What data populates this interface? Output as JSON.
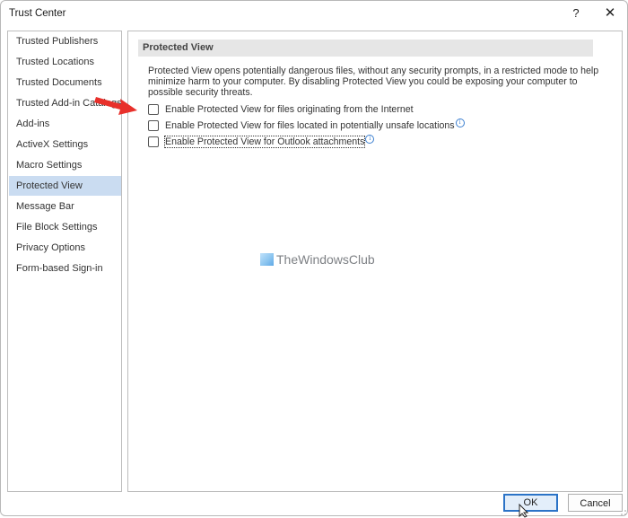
{
  "window": {
    "title": "Trust Center",
    "help_label": "?",
    "close_label": "✕"
  },
  "sidebar": {
    "selected_index": 8,
    "items": [
      {
        "label": "Trusted Publishers"
      },
      {
        "label": "Trusted Locations"
      },
      {
        "label": "Trusted Documents"
      },
      {
        "label": "Trusted Add-in Catalogs"
      },
      {
        "label": "Add-ins"
      },
      {
        "label": "ActiveX Settings"
      },
      {
        "label": "Macro Settings"
      },
      {
        "label": "Protected View"
      },
      {
        "label": "Message Bar"
      },
      {
        "label": "File Block Settings"
      },
      {
        "label": "Privacy Options"
      },
      {
        "label": "Form-based Sign-in"
      }
    ]
  },
  "main": {
    "section_title": "Protected View",
    "description": "Protected View opens potentially dangerous files, without any security prompts, in a restricted mode to help minimize harm to your computer. By disabling Protected View you could be exposing your computer to possible security threats.",
    "options": [
      {
        "label": "Enable Protected View for files originating from the Internet",
        "checked": false,
        "has_info": false,
        "focused": false
      },
      {
        "label": "Enable Protected View for files located in potentially unsafe locations",
        "checked": false,
        "has_info": true,
        "focused": false
      },
      {
        "label": "Enable Protected View for Outlook attachments",
        "checked": false,
        "has_info": true,
        "focused": true
      }
    ],
    "info_glyph": "i"
  },
  "watermark": {
    "text": "TheWindowsClub"
  },
  "footer": {
    "ok_label": "OK",
    "cancel_label": "Cancel"
  },
  "colors": {
    "selected_bg": "#cadcf1",
    "ok_border": "#2b73c7",
    "annotation_arrow": "#e8302b"
  }
}
